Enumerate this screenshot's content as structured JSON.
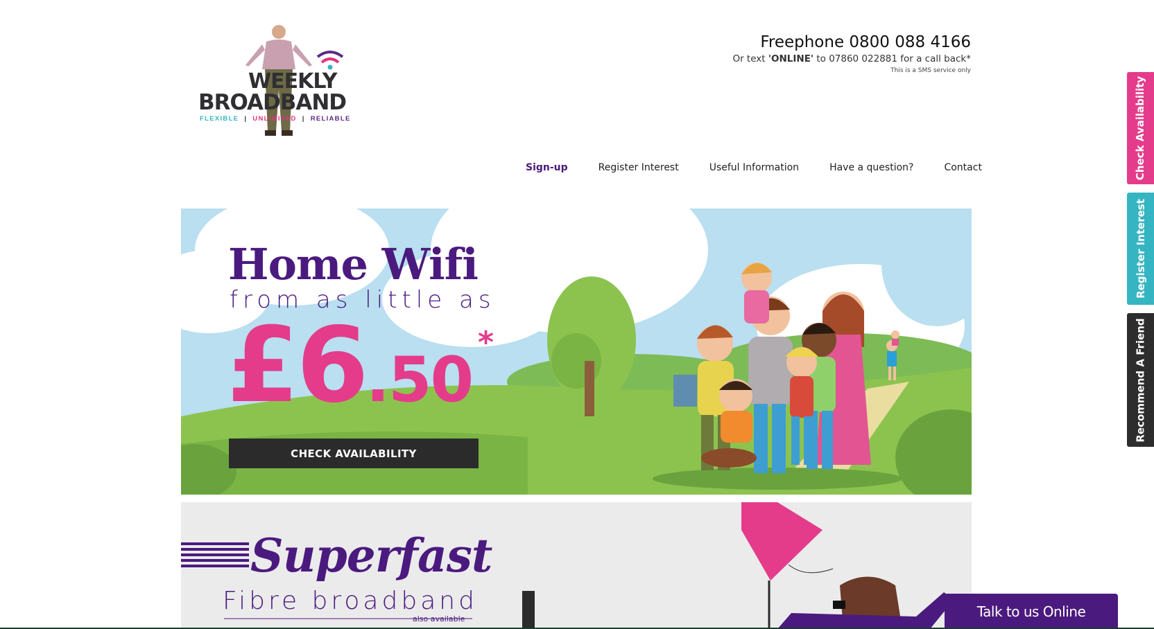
{
  "logo": {
    "line1": "WEEKLY",
    "line2": "BROADBAND",
    "tagline": [
      "FLEXIBLE",
      "UNLIMITED",
      "RELIABLE"
    ],
    "separator": "|"
  },
  "contact": {
    "freephone": "Freephone 0800 088 4166",
    "text_prefix": "Or text ",
    "text_keyword": "'ONLINE'",
    "text_suffix": " to 07860 022881 for a call back*",
    "sms_note": "This is a SMS service only"
  },
  "nav": {
    "items": [
      {
        "label": "Sign-up",
        "active": true
      },
      {
        "label": "Register Interest",
        "active": false
      },
      {
        "label": "Useful Information",
        "active": false
      },
      {
        "label": "Have a question?",
        "active": false
      },
      {
        "label": "Contact",
        "active": false
      }
    ]
  },
  "hero": {
    "title": "Home Wifi",
    "subtitle": "from as little as",
    "price_main": "£6",
    "price_decimal": ".50",
    "asterisk": "*",
    "cta_label": "CHECK AVAILABILITY"
  },
  "banner2": {
    "title": "Superfast",
    "subtitle": "Fibre broadband",
    "note": "also available"
  },
  "side_tabs": {
    "check": "Check Availability",
    "register": "Register Interest",
    "recommend": "Recommend A Friend"
  },
  "chat": {
    "label": "Talk to us Online"
  },
  "colors": {
    "purple": "#4b1a7e",
    "pink": "#e43c8b",
    "teal": "#35b5c2",
    "dark": "#2b2b2b",
    "grass": "#8cc34f",
    "sky": "#b9dff0"
  }
}
